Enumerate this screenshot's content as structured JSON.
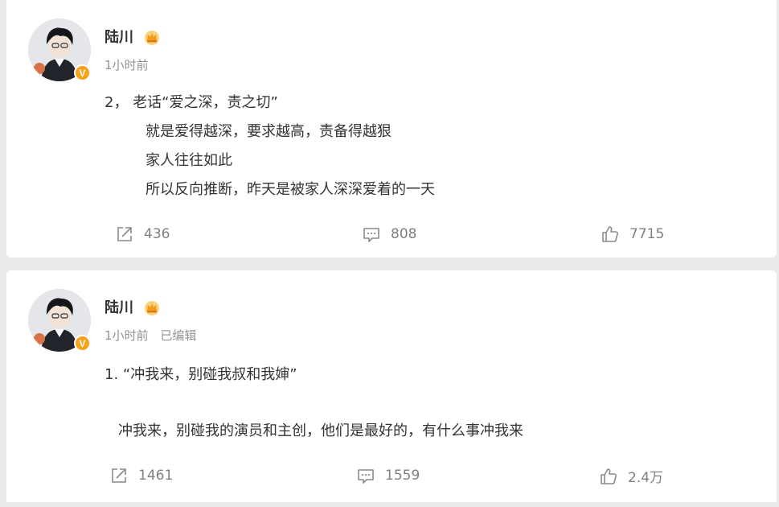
{
  "posts": [
    {
      "author": "陆川",
      "time": "1小时前",
      "edited": "",
      "verified_badge": "V",
      "lines": [
        "2， 老话“爱之深，责之切”",
        "就是爱得越深，要求越高，责备得越狠",
        "家人往往如此",
        "所以反向推断，昨天是被家人深深爱着的一天"
      ],
      "actions": {
        "share": "436",
        "comment": "808",
        "like": "7715"
      }
    },
    {
      "author": "陆川",
      "time": "1小时前",
      "edited": "已编辑",
      "verified_badge": "V",
      "lines": [
        "1. “冲我来，别碰我叔和我婶”",
        "冲我来，别碰我的演员和主创，他们是最好的，有什么事冲我来"
      ],
      "actions": {
        "share": "1461",
        "comment": "1559",
        "like": "2.4万"
      }
    }
  ],
  "icons": {
    "share": "share-icon",
    "comment": "comment-icon",
    "like": "thumbs-up-icon",
    "crown": "crown-badge-icon",
    "verified": "verified-v-badge"
  },
  "colors": {
    "badge_orange": "#f7a21a",
    "meta_gray": "#939393",
    "action_gray": "#808080",
    "background": "#eaeaea"
  }
}
